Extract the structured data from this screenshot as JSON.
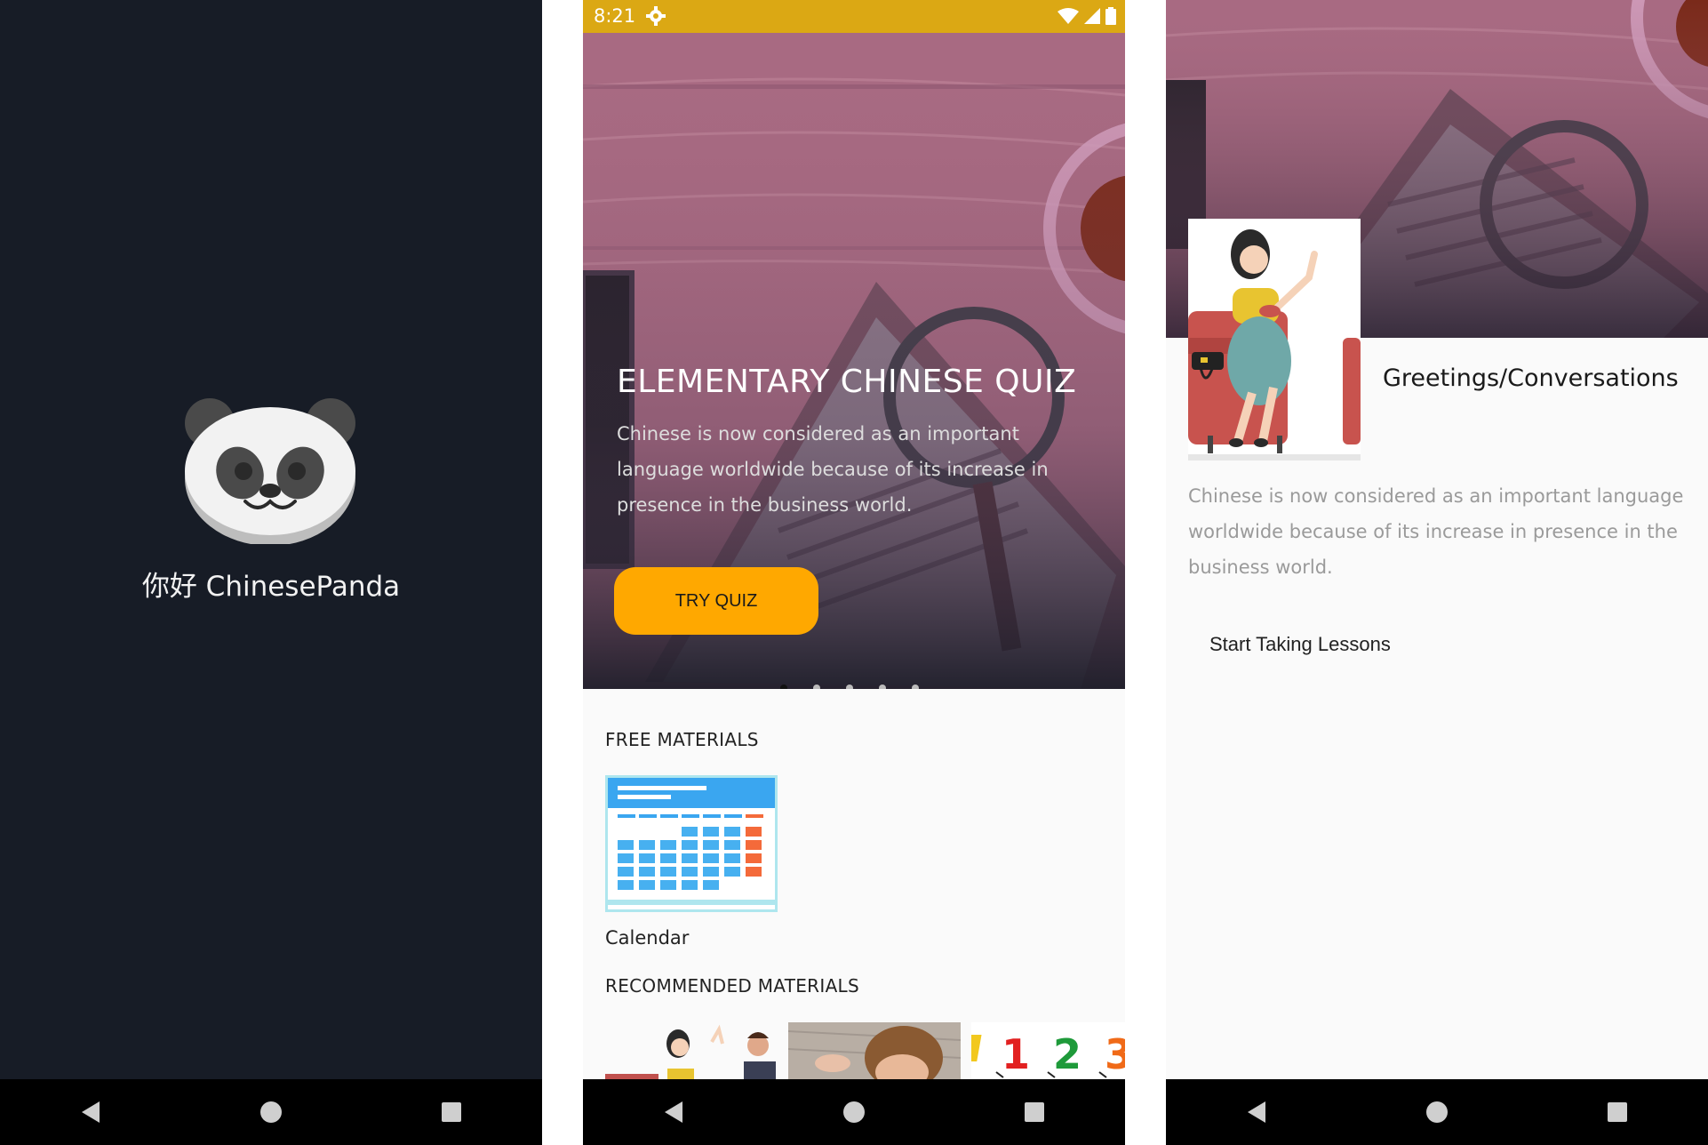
{
  "splash": {
    "app_name": "你好 ChinesePanda",
    "logo_icon": "panda-face-icon"
  },
  "home": {
    "status": {
      "time": "8:21"
    },
    "hero": {
      "title": "ELEMENTARY CHINESE QUIZ",
      "description": "Chinese is now considered as an important language worldwide because of its increase in presence in the business world.",
      "button_label": "TRY QUIZ",
      "carousel_pages": 5,
      "carousel_active": 0
    },
    "free_materials": {
      "heading": "FREE MATERIALS",
      "items": [
        {
          "label": "Calendar",
          "icon": "calendar-icon"
        }
      ]
    },
    "recommended_materials": {
      "heading": "RECOMMENDED MATERIALS",
      "items": [
        {
          "image": "conversation-thumbnail"
        },
        {
          "image": "child-thumbnail"
        },
        {
          "image": "numbers-thumbnail"
        }
      ]
    }
  },
  "lesson": {
    "title": "Greetings/Conversations",
    "description": "Chinese is now considered as an important language worldwide because of its increase in presence in the business world.",
    "button_label": "Start Taking Lessons"
  },
  "colors": {
    "splash_bg": "#171c26",
    "status_bar": "#dba814",
    "accent_button": "#ffa800",
    "hero_tint": "#a86a82"
  }
}
